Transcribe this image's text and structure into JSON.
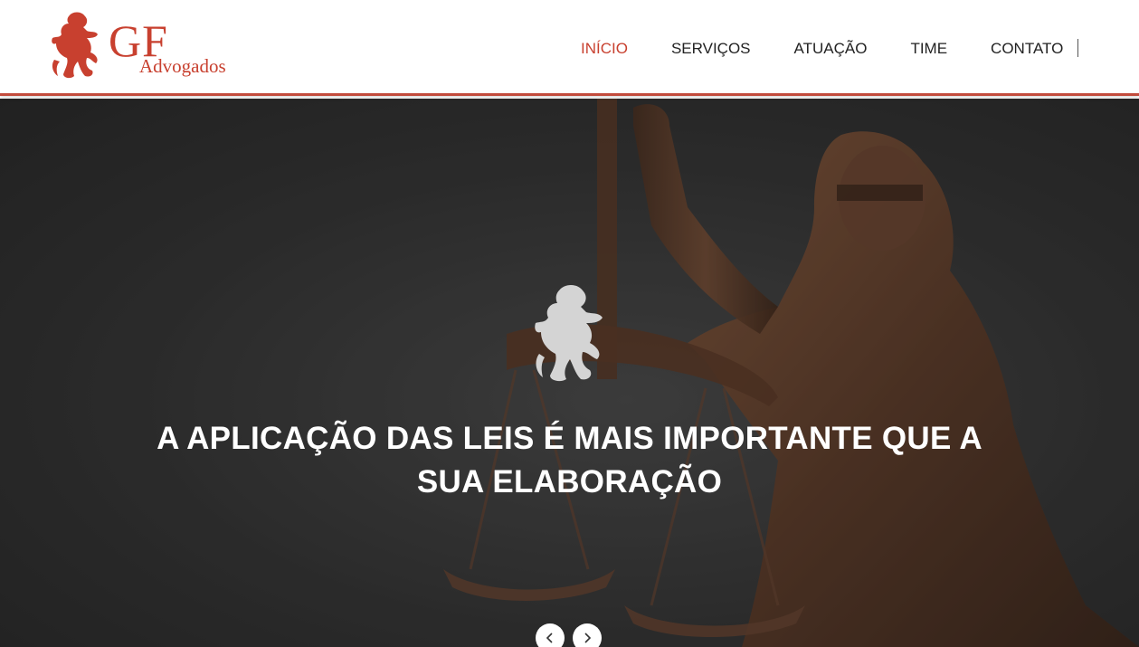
{
  "brand": {
    "mark": "GF",
    "subtitle": "Advogados",
    "color": "#c8402f"
  },
  "nav": {
    "items": [
      {
        "label": "INÍCIO",
        "active": true
      },
      {
        "label": "SERVIÇOS",
        "active": false
      },
      {
        "label": "ATUAÇÃO",
        "active": false
      },
      {
        "label": "TIME",
        "active": false
      },
      {
        "label": "CONTATO",
        "active": false
      }
    ]
  },
  "hero": {
    "headline": "A APLICAÇÃO DAS LEIS É MAIS IMPORTANTE QUE A SUA ELABORAÇÃO",
    "background": "lady-justice-statue",
    "emblem_icon": "lion-rampant-icon"
  },
  "carousel": {
    "prev_icon": "chevron-left-icon",
    "next_icon": "chevron-right-icon"
  },
  "colors": {
    "accent": "#c8402f",
    "nav_text": "#222222",
    "hero_text": "#ffffff"
  }
}
